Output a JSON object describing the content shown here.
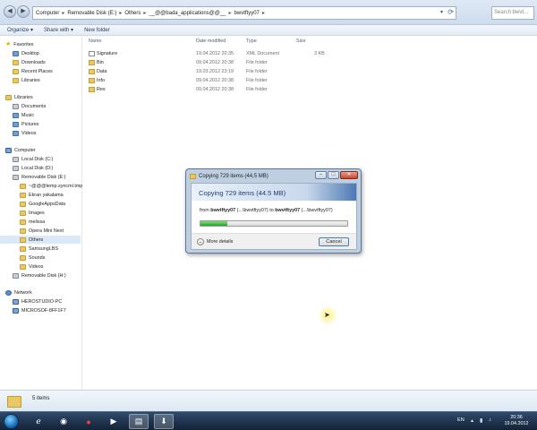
{
  "address_bar": {
    "back": "◀",
    "forward": "▶",
    "crumbs": [
      "Computer",
      "Removable Disk (E:)",
      "Others",
      "__@@bada_applications@@__",
      "bwvtftyy07"
    ],
    "search_placeholder": "Search bwvt..."
  },
  "toolbar": {
    "organize": "Organize ▾",
    "share": "Share with ▾",
    "new_folder": "New folder"
  },
  "nav": {
    "favorites": "Favorites",
    "desktop": "Desktop",
    "downloads": "Downloads",
    "recent": "Recent Places",
    "libraries_fav": "Libraries",
    "libraries": "Libraries",
    "documents": "Documents",
    "music": "Music",
    "pictures": "Pictures",
    "videos": "Videos",
    "computer": "Computer",
    "local_c": "Local Disk (C:)",
    "local_d": "Local Disk (D:)",
    "removable_e": "Removable Disk (E:)",
    "temp": "~@@@temp.syncml.tmp",
    "ekran": "Ekran yakalama",
    "google": "GoogleAppsData",
    "images": "Images",
    "melissa": "melissa",
    "opera": "Opera Mini Next",
    "others": "Others",
    "samsung": "SamsungLBS",
    "sounds": "Sounds",
    "videos2": "Videos",
    "removable_h": "Removable Disk (H:)",
    "network": "Network",
    "pc1": "HEROSTUDIO-PC",
    "pc2": "MICROSOF-8FF1F7"
  },
  "columns": {
    "name": "Name",
    "date": "Date modified",
    "type": "Type",
    "size": "Size"
  },
  "files": [
    {
      "name": "Signature",
      "date": "19.04.2012 20:35",
      "type": "XML Document",
      "size": "3 KB"
    },
    {
      "name": "Bin",
      "date": "09.04.2012 20:38",
      "type": "File folder",
      "size": ""
    },
    {
      "name": "Data",
      "date": "19.03.2012 23:19",
      "type": "File folder",
      "size": ""
    },
    {
      "name": "Info",
      "date": "09.04.2012 20:38",
      "type": "File folder",
      "size": ""
    },
    {
      "name": "Res",
      "date": "09.04.2012 20:38",
      "type": "File folder",
      "size": ""
    }
  ],
  "status": {
    "count": "5 items"
  },
  "dialog": {
    "title": "Copying 729 items (44,5 MB)",
    "heading": "Copying 729 items (44.5 MB)",
    "from_label": "from",
    "from_name": "bwvtftyy07",
    "from_path": "(...\\bwvtftyy07)",
    "to_label": "to",
    "to_name": "bwvtftyy07",
    "to_path": "(...\\bwvtftyy07)",
    "progress": 0.18,
    "more_details": "More details",
    "cancel": "Cancel",
    "minimize": "–",
    "maximize": "□",
    "close": "✕"
  },
  "taskbar": {
    "lang": "EN",
    "time": "20:36",
    "date": "19.04.2012"
  }
}
